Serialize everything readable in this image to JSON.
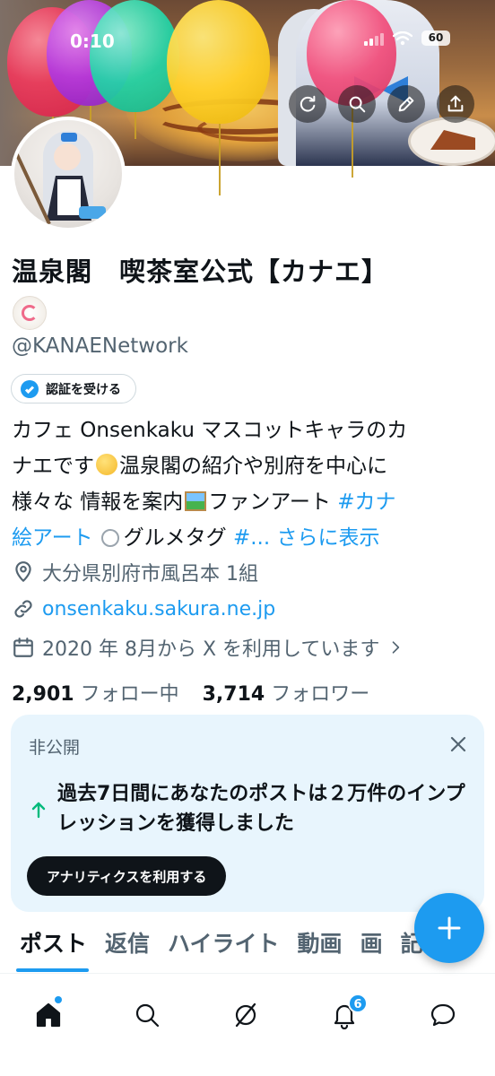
{
  "status_bar": {
    "time": "0:10",
    "battery": "60"
  },
  "banner_actions": [
    {
      "icon": "refresh-icon"
    },
    {
      "icon": "search-icon"
    },
    {
      "icon": "edit-icon"
    },
    {
      "icon": "share-icon"
    }
  ],
  "profile": {
    "display_name": "温泉閣　喫茶室公式【カナエ】",
    "handle": "@KANAENetwork",
    "verify_label": "認証を受ける",
    "bio": {
      "line1": "カフェ Onsenkaku マスコットキャラのカ",
      "line2_a": "ナエです",
      "line2_b": "温泉閣の紹介や別府を中心に",
      "line3_a": "様々な 情報を案内",
      "line3_b": "ファンアート ",
      "line3_tag": "#カナ",
      "line4_tag": "絵アート",
      "line4_b": "グルメタグ ",
      "line4_tag2": "#...",
      "more": "さらに表示"
    },
    "location": "大分県別府市風呂本 1組",
    "website": "onsenkaku.sakura.ne.jp",
    "joined": "2020 年 8月から X を利用しています",
    "following_count": "2,901",
    "following_label": "フォロー中",
    "followers_count": "3,714",
    "followers_label": "フォロワー"
  },
  "private_card": {
    "label": "非公開",
    "message": "過去7日間にあなたのポストは２万件のインプレッションを獲得しました",
    "button": "アナリティクスを利用する"
  },
  "tabs": [
    "ポスト",
    "返信",
    "ハイライト",
    "動画",
    "画",
    "記"
  ],
  "bottom_nav": {
    "items": [
      "home-icon",
      "search-icon",
      "grok-icon",
      "notifications-icon",
      "messages-icon"
    ],
    "notification_count": "6"
  },
  "colors": {
    "accent": "#1d9bf0",
    "text": "#0f1419",
    "secondary": "#536471",
    "card_bg": "#e8f5fd",
    "up_arrow": "#00ba7c"
  }
}
